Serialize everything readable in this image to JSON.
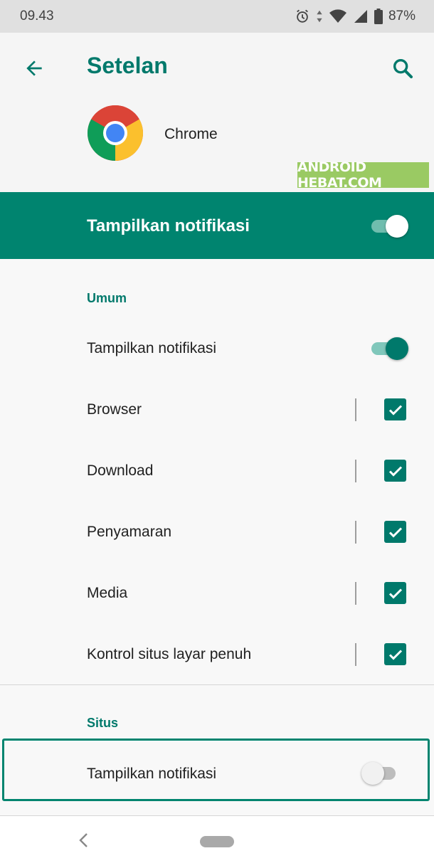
{
  "status_bar": {
    "time": "09.43",
    "battery": "87%",
    "icons": [
      "alarm-icon",
      "data-arrows-icon",
      "wifi-icon",
      "signal-icon",
      "battery-icon"
    ]
  },
  "app_bar": {
    "title": "Setelan",
    "back_icon": "arrow-back-icon",
    "search_icon": "search-icon"
  },
  "app_header": {
    "app_name": "Chrome",
    "logo_icon": "chrome-logo-icon",
    "watermark": "ANDROID HEBAT.COM"
  },
  "master_toggle": {
    "label": "Tampilkan notifikasi",
    "checked": true
  },
  "sections": {
    "umum": {
      "header": "Umum",
      "toggle_label": "Tampilkan notifikasi",
      "toggle_checked": true,
      "items": [
        {
          "label": "Browser",
          "checked": true
        },
        {
          "label": "Download",
          "checked": true
        },
        {
          "label": "Penyamaran",
          "checked": true
        },
        {
          "label": "Media",
          "checked": true
        },
        {
          "label": "Kontrol situs layar penuh",
          "checked": true
        }
      ]
    },
    "situs": {
      "header": "Situs",
      "toggle_label": "Tampilkan notifikasi",
      "toggle_checked": false
    }
  },
  "colors": {
    "accent": "#00796b",
    "master_bar": "#00846f",
    "watermark_bg": "#8bc34a"
  },
  "nav_bar": {
    "back_icon": "nav-back-icon",
    "home_icon": "nav-home-pill-icon"
  }
}
